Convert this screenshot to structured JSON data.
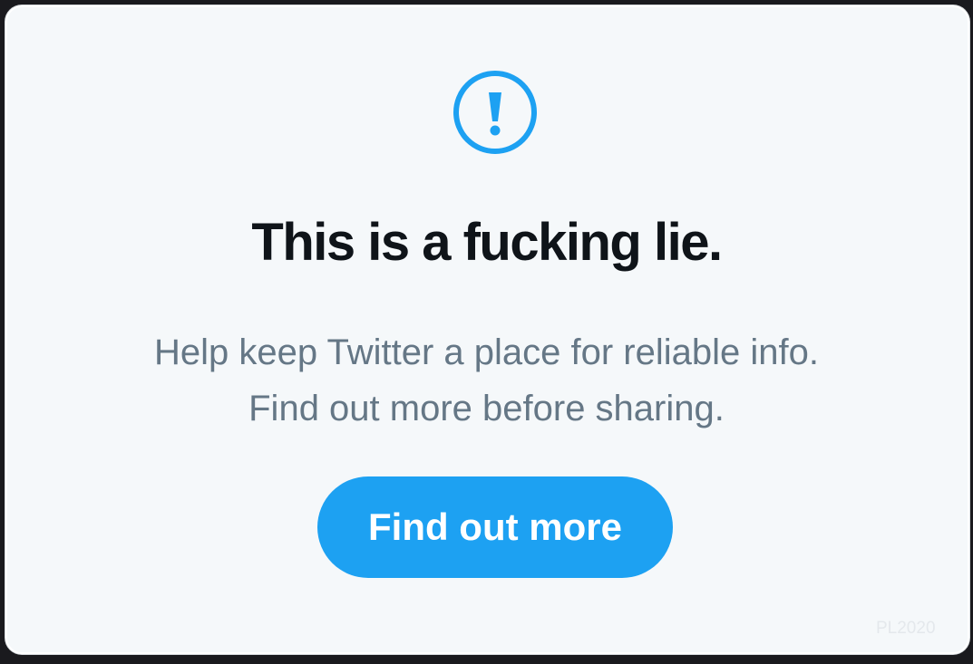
{
  "icon": "alert-circle-icon",
  "accent_color": "#1da1f2",
  "headline": "This is a fucking lie.",
  "body_lines": [
    "Help keep Twitter a place for reliable info.",
    "Find out more before sharing."
  ],
  "cta_label": "Find out more",
  "watermark": "PL2020"
}
